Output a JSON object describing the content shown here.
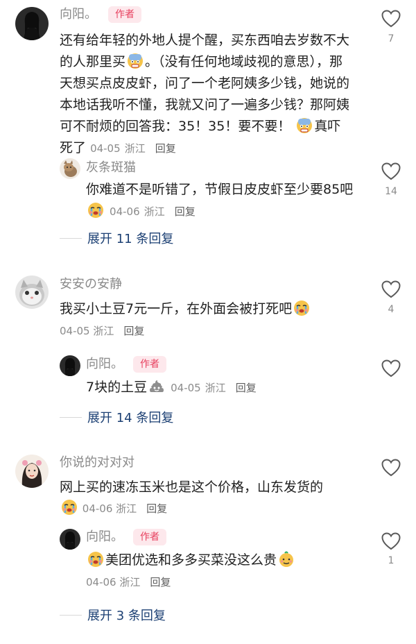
{
  "comments": [
    {
      "user": "向阳。",
      "badge": "作者",
      "text": "还有给年轻的外地人提个醒，买东西咱去岁数不大的人那里买",
      "text_after_emoji": "。（没有任何地域歧视的意思），那天想买点皮皮虾，问了一个老阿姨多少钱，她说的本地话我听不懂，我就又问了一遍多少钱？那阿姨可不耐烦的回答我：35！35！要不要！",
      "text_end": "真吓死了",
      "date": "04-05",
      "location": "浙江",
      "reply_label": "回复",
      "likes": "7",
      "replies": [
        {
          "user": "灰条斑猫",
          "text": "你难道不是听错了，节假日皮皮虾至少要85吧",
          "date": "04-06",
          "location": "浙江",
          "reply_label": "回复",
          "likes": "14"
        }
      ],
      "expand_label": "展开 11 条回复"
    },
    {
      "user": "安安の安静",
      "text": "我买小土豆7元一斤，在外面会被打死吧",
      "date": "04-05",
      "location": "浙江",
      "reply_label": "回复",
      "likes": "4",
      "replies": [
        {
          "user": "向阳。",
          "badge": "作者",
          "text": "7块的土豆",
          "date": "04-05",
          "location": "浙江",
          "reply_label": "回复",
          "likes": ""
        }
      ],
      "expand_label": "展开 14 条回复"
    },
    {
      "user": "你说的对对对",
      "text": "网上买的速冻玉米也是这个价格，山东发货的",
      "date": "04-06",
      "location": "浙江",
      "reply_label": "回复",
      "likes": "",
      "replies": [
        {
          "user": "向阳。",
          "badge": "作者",
          "text": "美团优选和多多买菜没这么贵",
          "date": "04-06",
          "location": "浙江",
          "reply_label": "回复",
          "likes": "1"
        }
      ],
      "expand_label": "展开 3 条回复"
    }
  ],
  "colors": {
    "author_badge": "#e8415f",
    "expand_link": "#1b3f73",
    "meta": "#8a8a8a"
  },
  "icons": [
    "heart-outline-icon",
    "scared-face-emoji",
    "crying-face-emoji",
    "poop-emoji",
    "grimace-face-emoji"
  ]
}
